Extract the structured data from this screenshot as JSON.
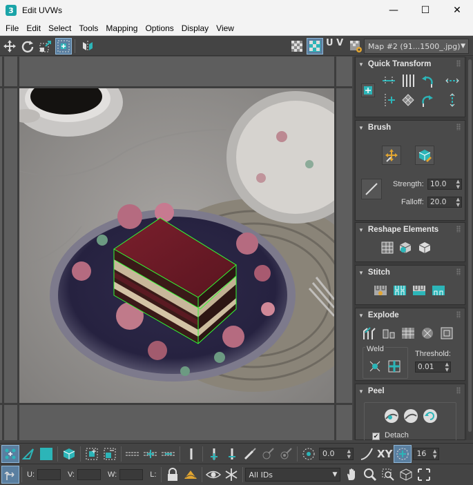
{
  "window": {
    "app_icon_text": "3",
    "title": "Edit UVWs",
    "minimize": "—",
    "maximize": "☐",
    "close": "✕"
  },
  "menu": [
    "File",
    "Edit",
    "Select",
    "Tools",
    "Mapping",
    "Options",
    "Display",
    "View"
  ],
  "toolbar": {
    "uv_label": "U V",
    "map_select": "Map #2 (91...1500_.jpg)"
  },
  "panel": {
    "quick_transform": {
      "title": "Quick Transform"
    },
    "brush": {
      "title": "Brush",
      "strength_label": "Strength:",
      "strength_value": "10.0",
      "falloff_label": "Falloff:",
      "falloff_value": "20.0"
    },
    "reshape": {
      "title": "Reshape Elements"
    },
    "stitch": {
      "title": "Stitch"
    },
    "explode": {
      "title": "Explode",
      "weld_label": "Weld",
      "threshold_label": "Threshold:",
      "threshold_value": "0.01"
    },
    "peel": {
      "title": "Peel",
      "detach_label": "Detach"
    }
  },
  "bottom": {
    "angle_value": "0.0",
    "xy_label": "XY",
    "grid_value": "16",
    "u_label": "U:",
    "v_label": "V:",
    "w_label": "W:",
    "l_label": "L:",
    "ids_select": "All IDs"
  },
  "colors": {
    "accent": "#2cb5b8",
    "selection_wire": "#33ff33",
    "active_blue": "#5a7fa0"
  }
}
